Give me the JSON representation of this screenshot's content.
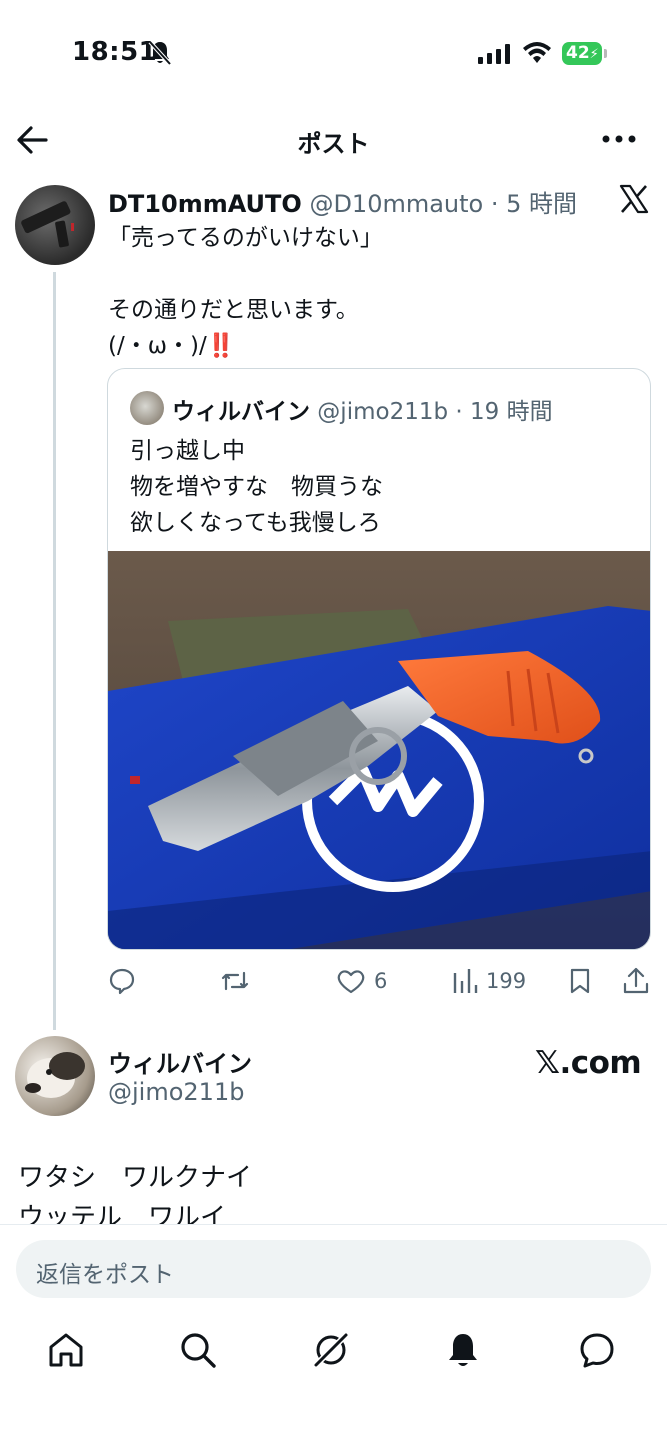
{
  "status_bar": {
    "time": "18:51",
    "battery": "42"
  },
  "header": {
    "title": "ポスト"
  },
  "tweet": {
    "author_name": "DT10mmAUTO",
    "author_meta": " @D10mmauto · 5 時間",
    "text": "「売ってるのがいけない」\n\nその通りだと思います。\n(/・ω・)/",
    "emoji": "‼️",
    "quote": {
      "author_name": "ウィルバイン",
      "author_meta": " @jimo211b · 19 時間",
      "text": "引っ越し中\n物を増やすな　物買うな\n欲しくなっても我慢しろ"
    },
    "actions": {
      "likes": "6",
      "views": "199"
    }
  },
  "reply_preview": {
    "name": "ウィルバイン",
    "handle": "@jimo211b",
    "site": "𝕏.com",
    "body": "ワタシ　ワルクナイ\nウッテル　ワルイ"
  },
  "compose": {
    "placeholder": "返信をポスト"
  },
  "tabbar": {
    "items": [
      "home-icon",
      "search-icon",
      "grok-icon",
      "notifications-icon",
      "messages-icon"
    ]
  },
  "colors": {
    "accent_blue": "#1d9bf0",
    "muted_text": "#536471",
    "battery_green": "#34c759",
    "emoji_red": "#e0245e"
  }
}
